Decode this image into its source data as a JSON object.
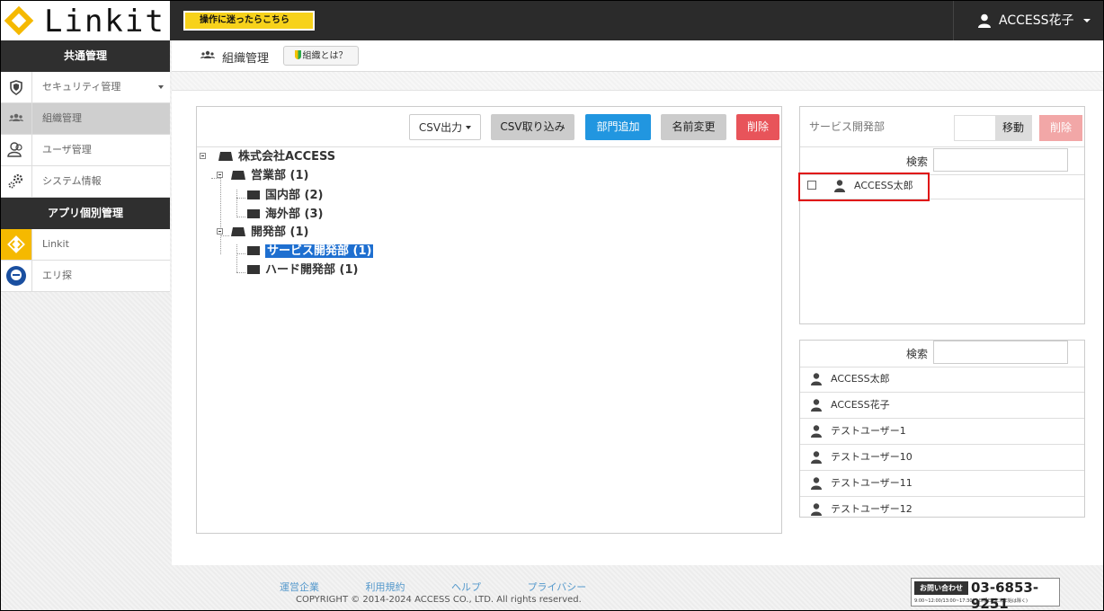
{
  "app": {
    "logo_text": "Linkit",
    "help_button": "操作に迷ったらこちら"
  },
  "user_menu": {
    "name": "ACCESS花子"
  },
  "sidebar": {
    "common_header": "共通管理",
    "common_items": [
      {
        "label": "セキュリティ管理",
        "icon": "shield-icon"
      },
      {
        "label": "組織管理",
        "icon": "group-icon"
      },
      {
        "label": "ユーザ管理",
        "icon": "users-icon"
      },
      {
        "label": "システム情報",
        "icon": "gears-icon"
      }
    ],
    "app_header": "アプリ個別管理",
    "app_items": [
      {
        "label": "Linkit",
        "icon": "linkit-icon"
      },
      {
        "label": "エリ探",
        "icon": "erisagashi-icon"
      }
    ]
  },
  "page": {
    "title": "組織管理",
    "what_button": "組織とは？"
  },
  "toolbar": {
    "csv_export": "CSV出力",
    "csv_import": "CSV取り込み",
    "add_dept": "部門追加",
    "rename": "名前変更",
    "delete": "削除"
  },
  "tree": {
    "root": "株式会社ACCESS",
    "nodes": [
      {
        "label": "営業部 (1)"
      },
      {
        "label": "国内部 (2)"
      },
      {
        "label": "海外部 (3)"
      },
      {
        "label": "開発部 (1)"
      },
      {
        "label": "サービス開発部 (1)"
      },
      {
        "label": "ハード開発部 (1)"
      }
    ]
  },
  "members": {
    "dept_name": "サービス開発部",
    "move_button": "移動",
    "delete_button": "削除",
    "search_label": "検索",
    "rows": [
      {
        "name": "ACCESS太郎"
      }
    ]
  },
  "users": {
    "search_label": "検索",
    "rows": [
      {
        "name": "ACCESS太郎"
      },
      {
        "name": "ACCESS花子"
      },
      {
        "name": "テストユーザー1"
      },
      {
        "name": "テストユーザー10"
      },
      {
        "name": "テストユーザー11"
      },
      {
        "name": "テストユーザー12"
      }
    ]
  },
  "footer": {
    "links": [
      "運営企業",
      "利用規約",
      "ヘルプ",
      "プライバシー"
    ],
    "copyright": "COPYRIGHT © 2014-2024 ACCESS CO., LTD. All rights reserved.",
    "contact_badge": "お問い合わせ",
    "phone": "03-6853-9251",
    "hours": "9:00~12:00/13:00~17:30(土日祝日･年末年始は除く)"
  },
  "colors": {
    "primary": "#2196e0",
    "danger": "#e8545a",
    "brand": "#f5b900",
    "selected": "#1e6fd0"
  }
}
